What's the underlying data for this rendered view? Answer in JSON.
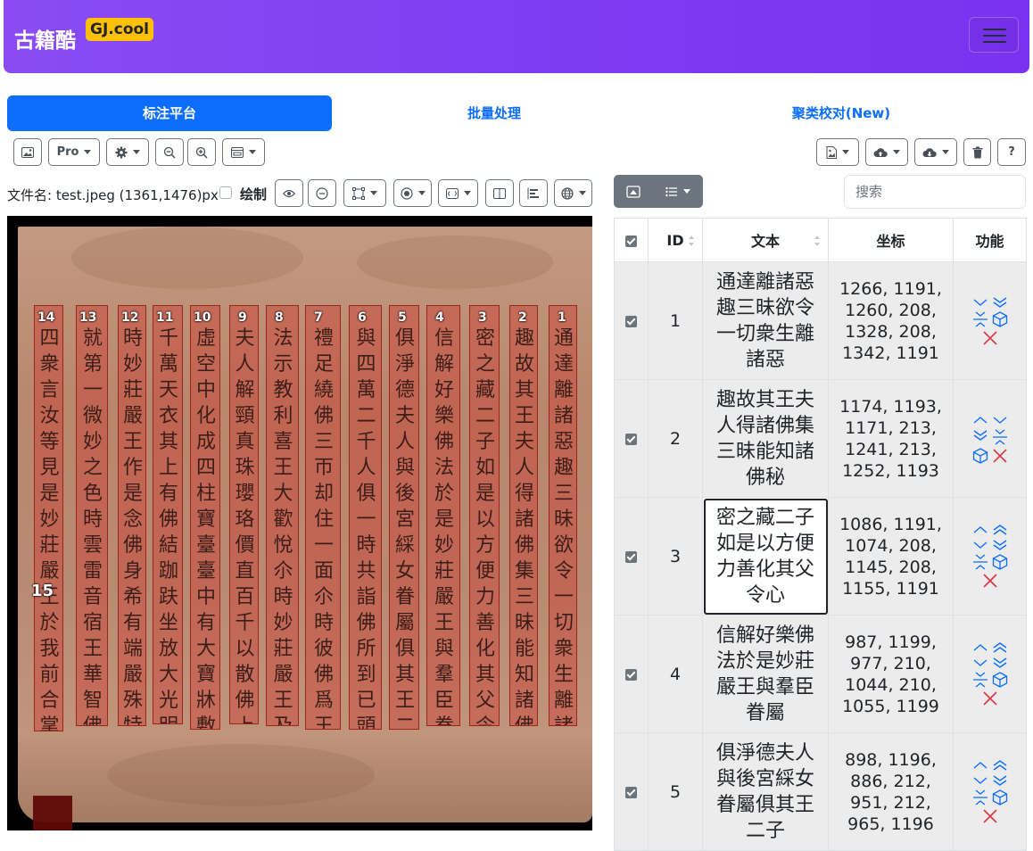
{
  "navbar": {
    "brand": "古籍酷",
    "badge": "GJ.cool"
  },
  "tabs": [
    {
      "label": "标注平台",
      "active": true
    },
    {
      "label": "批量处理",
      "active": false
    },
    {
      "label": "聚类校对(New)",
      "active": false
    }
  ],
  "toolbar": {
    "pro_label": "Pro"
  },
  "file": {
    "name": "文件名: test.jpeg (1361,1476)px",
    "draw_label": "绘制"
  },
  "search": {
    "placeholder": "搜索"
  },
  "colors": {
    "primary": "#0d6efd",
    "nav": "#7e3cf2",
    "badge": "#ffc107",
    "secondary": "#6c757d",
    "danger": "#dc3545"
  },
  "columns": [
    {
      "num": "1",
      "text": "通達離諸惡趣三昧欲令一切衆生離諸惡"
    },
    {
      "num": "2",
      "text": "趣故其王夫人得諸佛集三昧能知諸佛秘"
    },
    {
      "num": "3",
      "text": "密之藏二子如是以方便力善化其父令心"
    },
    {
      "num": "4",
      "text": "信解好樂佛法於是妙莊嚴王與羣臣眷屬"
    },
    {
      "num": "5",
      "text": "俱淨德夫人與後宮綵女眷屬俱其王二子"
    },
    {
      "num": "6",
      "text": "與四萬二千人俱一時共詣佛所到已頭面"
    },
    {
      "num": "7",
      "text": "禮足繞佛三帀却住一面尒時彼佛爲王說"
    },
    {
      "num": "8",
      "text": "法示教利喜王大歡悅尒時妙莊嚴王及其"
    },
    {
      "num": "9",
      "text": "夫人解頸真珠瓔珞價直百千以散佛上於"
    },
    {
      "num": "10",
      "text": "虛空中化成四柱寶臺臺中有大寶牀敷百"
    },
    {
      "num": "11",
      "text": "千萬天衣其上有佛結跏趺坐放大光明尒"
    },
    {
      "num": "12",
      "text": "時妙莊嚴王作是念佛身希有端嚴殊特成"
    },
    {
      "num": "13",
      "text": "就第一微妙之色時雲雷音宿王華智佛告"
    },
    {
      "num": "14",
      "text": "四衆言汝等見是妙莊嚴王於我前合掌立"
    },
    {
      "num": "15",
      "text": ""
    }
  ],
  "table": {
    "headers": {
      "id": "ID",
      "text": "文本",
      "coord": "坐标",
      "func": "功能"
    },
    "rows": [
      {
        "id": "1",
        "text": "通達離諸惡趣三昧欲令一切衆生離諸惡",
        "coord": "1266, 1191, 1260, 208, 1328, 208, 1342, 1191"
      },
      {
        "id": "2",
        "text": "趣故其王夫人得諸佛集三昧能知諸佛秘",
        "coord": "1174, 1193, 1171, 213, 1241, 213, 1252, 1193"
      },
      {
        "id": "3",
        "text": "密之藏二子如是以方便力善化其父令心",
        "coord": "1086, 1191, 1074, 208, 1145, 208, 1155, 1191"
      },
      {
        "id": "4",
        "text": "信解好樂佛法於是妙莊嚴王與羣臣眷屬",
        "coord": "987, 1199, 977, 210, 1044, 210, 1055, 1199"
      },
      {
        "id": "5",
        "text": "俱淨德夫人與後宮綵女眷屬俱其王二子",
        "coord": "898, 1196, 886, 212, 951, 212, 965, 1196"
      }
    ]
  }
}
